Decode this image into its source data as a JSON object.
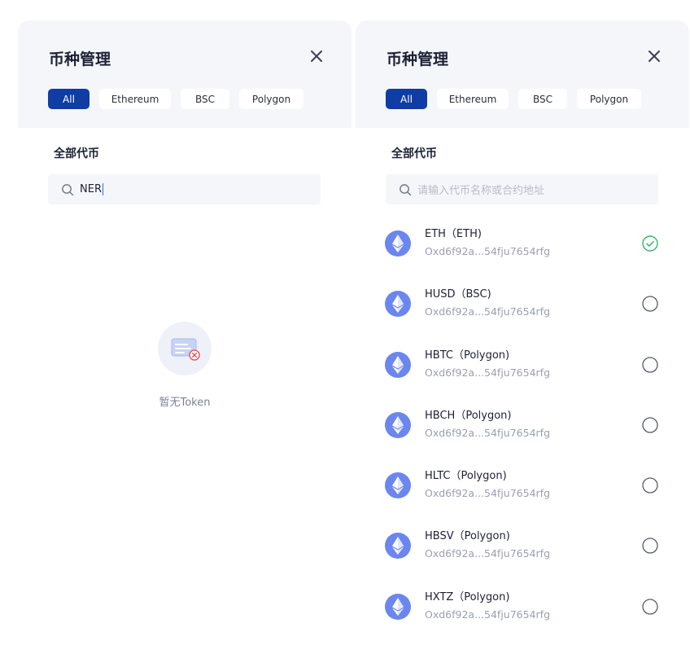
{
  "left_panel": {
    "title": "币种管理",
    "tabs": [
      "All",
      "Ethereum",
      "BSC",
      "Polygon"
    ],
    "active_tab": "All",
    "section_title": "全部代币",
    "search": {
      "value": "NER"
    },
    "empty": {
      "text": "暂无Token",
      "icon": "empty-card-error-icon"
    }
  },
  "right_panel": {
    "title": "币种管理",
    "tabs": [
      "All",
      "Ethereum",
      "BSC",
      "Polygon"
    ],
    "active_tab": "All",
    "section_title": "全部代币",
    "search": {
      "placeholder": "请输入代币名称或合约地址",
      "value": ""
    },
    "tokens": [
      {
        "name": "ETH（ETH)",
        "address": "Oxd6f92a...54fju7654rfg",
        "selected": true
      },
      {
        "name": "HUSD（BSC)",
        "address": "Oxd6f92a...54fju7654rfg",
        "selected": false
      },
      {
        "name": "HBTC（Polygon)",
        "address": "Oxd6f92a...54fju7654rfg",
        "selected": false
      },
      {
        "name": "HBCH（Polygon)",
        "address": "Oxd6f92a...54fju7654rfg",
        "selected": false
      },
      {
        "name": "HLTC（Polygon)",
        "address": "Oxd6f92a...54fju7654rfg",
        "selected": false
      },
      {
        "name": "HBSV（Polygon)",
        "address": "Oxd6f92a...54fju7654rfg",
        "selected": false
      },
      {
        "name": "HXTZ（Polygon)",
        "address": "Oxd6f92a...54fju7654rfg",
        "selected": false
      }
    ]
  },
  "icons": {
    "close": "close-icon",
    "search": "search-icon",
    "token": "ethereum-icon",
    "selected": "check-circle-icon",
    "unselected": "radio-empty-icon"
  },
  "colors": {
    "accent": "#0f3da3",
    "header_bg": "#f5f6fa",
    "token_icon": "#6b86ee",
    "check": "#2fb86a",
    "error": "#e5484d"
  }
}
